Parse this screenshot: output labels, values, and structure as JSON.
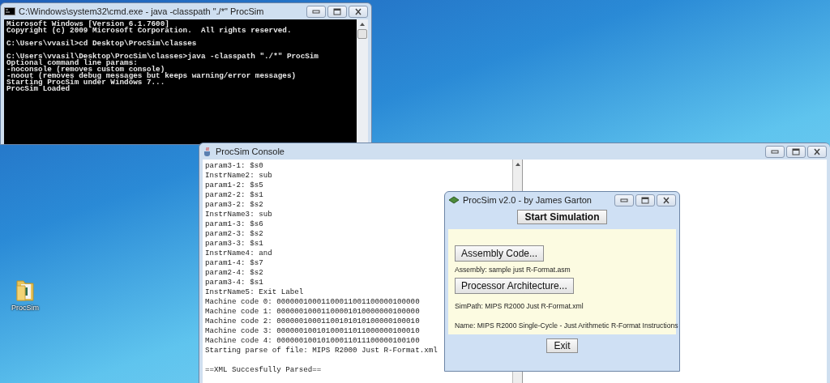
{
  "desktop_icons": [
    {
      "label": "ProcSim"
    }
  ],
  "cmd_window": {
    "title": "C:\\Windows\\system32\\cmd.exe - java  -classpath \"./*\" ProcSim",
    "blocks": [
      [
        "Microsoft Windows [Version 6.1.7600]",
        "Copyright (c) 2009 Microsoft Corporation.  All rights reserved."
      ],
      [
        "C:\\Users\\vvasil>cd Desktop\\ProcSim\\classes"
      ],
      [
        "C:\\Users\\vvasil\\Desktop\\ProcSim\\classes>java -classpath \"./*\" ProcSim",
        "Optional command line params:",
        "-noconsole (removes custom console)",
        "-noout (removes debug messages but keeps warning/error messages)",
        "Starting ProcSim under Windows 7...",
        "ProcSim Loaded"
      ]
    ]
  },
  "console_window": {
    "title": "ProcSim Console",
    "blocks": [
      [
        "param3-1: $s0",
        "InstrName2: sub",
        "param1-2: $s5",
        "param2-2: $s1",
        "param3-2: $s2",
        "InstrName3: sub",
        "param1-3: $s6",
        "param2-3: $s2",
        "param3-3: $s1",
        "InstrName4: and",
        "param1-4: $s7",
        "param2-4: $s2",
        "param3-4: $s1",
        "InstrName5: Exit Label",
        "Machine code 0: 00000010001100011001100000100000",
        "Machine code 1: 00000010001100001010000000100000",
        "Machine code 2: 00000010001100101010100000100010",
        "Machine code 3: 00000010010100011011000000100010",
        "Machine code 4: 00000010010100011011100000100100",
        "Starting parse of file: MIPS R2000 Just R-Format.xml"
      ],
      [
        "==XML Succesfully Parsed=="
      ]
    ]
  },
  "dialog": {
    "title": "ProcSim v2.0 - by James Garton",
    "start_button": "Start Simulation",
    "assembly_button": "Assembly Code...",
    "assembly_label": "Assembly: sample just R-Format.asm",
    "architecture_button": "Processor Architecture...",
    "simpath_label": "SimPath: MIPS R2000 Just R-Format.xml",
    "name_label": "Name: MIPS R2000 Single-Cycle - Just Arithmetic R-Format Instructions",
    "exit_button": "Exit"
  }
}
